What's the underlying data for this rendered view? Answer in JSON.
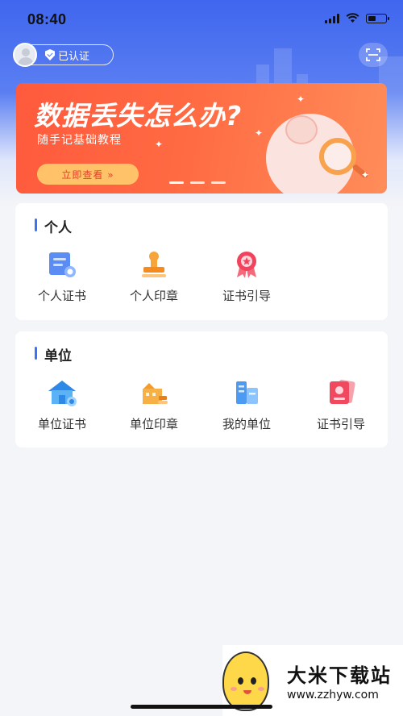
{
  "status_bar": {
    "time": "08:40",
    "icons": [
      "cellular-signal-icon",
      "wifi-icon",
      "battery-icon"
    ]
  },
  "header": {
    "verified_label": "已认证",
    "icons": {
      "avatar": "avatar-icon",
      "verified": "shield-check-icon",
      "scan": "scan-icon"
    }
  },
  "banner": {
    "title": "数据丢失怎么办?",
    "subtitle": "随手记基础教程",
    "button_label": "立即查看 »",
    "slide_count": 3,
    "active_slide": 1
  },
  "personal": {
    "title": "个人",
    "items": [
      {
        "label": "个人证书",
        "icon": "certificate-icon"
      },
      {
        "label": "个人印章",
        "icon": "stamp-icon"
      },
      {
        "label": "证书引导",
        "icon": "award-ribbon-icon"
      }
    ]
  },
  "organization": {
    "title": "单位",
    "items": [
      {
        "label": "单位证书",
        "icon": "building-certificate-icon"
      },
      {
        "label": "单位印章",
        "icon": "building-stamp-icon"
      },
      {
        "label": "我的单位",
        "icon": "my-organization-icon"
      },
      {
        "label": "证书引导",
        "icon": "certificate-guide-icon"
      }
    ]
  },
  "watermark": {
    "name": "大米下载站",
    "url": "www.zzhyw.com"
  },
  "colors": {
    "header_blue": "#3f66ee",
    "banner_orange": "#ff5a3d",
    "banner_button": "#ffc268",
    "accent_bar": "#3b74f2",
    "page_background": "#f4f5f8"
  }
}
